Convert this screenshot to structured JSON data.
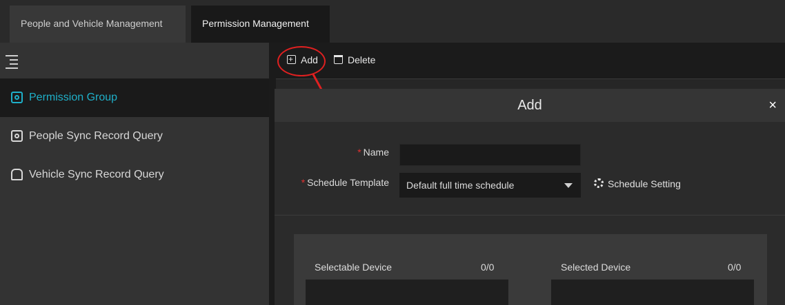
{
  "tabs": [
    {
      "label": "People and Vehicle Management",
      "active": false
    },
    {
      "label": "Permission Management",
      "active": true
    }
  ],
  "sidebar": {
    "toggle_icon": "menu-collapse-icon",
    "items": [
      {
        "label": "Permission Group",
        "icon": "permission-group-icon",
        "active": true
      },
      {
        "label": "People Sync Record Query",
        "icon": "people-sync-icon",
        "active": false
      },
      {
        "label": "Vehicle Sync Record Query",
        "icon": "vehicle-sync-icon",
        "active": false
      }
    ]
  },
  "toolbar": {
    "add_label": "Add",
    "delete_label": "Delete"
  },
  "modal": {
    "title": "Add",
    "close": "×",
    "name_label": "Name",
    "name_value": "",
    "required_mark": "*",
    "schedule_label": "Schedule Template",
    "schedule_value": "Default full time schedule",
    "schedule_setting_label": "Schedule Setting",
    "selectable_title": "Selectable Device",
    "selectable_count": "0/0",
    "selected_title": "Selected Device",
    "selected_count": "0/0"
  },
  "colors": {
    "accent": "#1fb0c9",
    "annotation_red": "#e02020",
    "required": "#e03030"
  }
}
